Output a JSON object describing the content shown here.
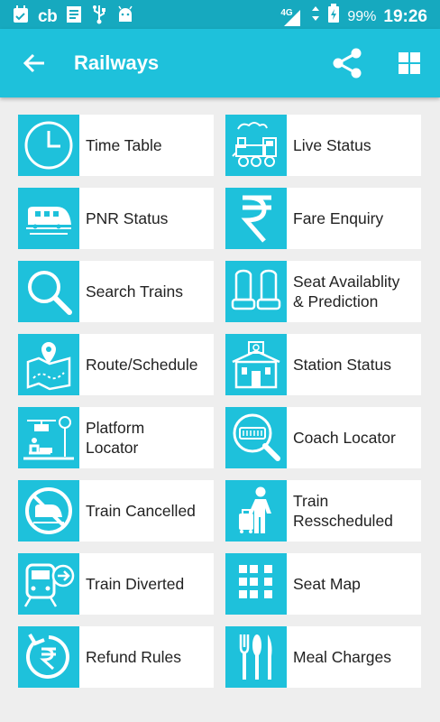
{
  "status_bar": {
    "left_icons": [
      "calendar-check-icon",
      "cb-icon",
      "document-icon",
      "usb-icon",
      "android-icon"
    ],
    "cb_text": "cb",
    "network": "4G",
    "battery": "99%",
    "time": "19:26"
  },
  "app_bar": {
    "title": "Railways",
    "back_icon": "arrow-back-icon",
    "share_icon": "share-icon",
    "grid_icon": "grid-view-icon"
  },
  "colors": {
    "status_bar": "#16a9bf",
    "app_bar": "#1ec1db",
    "icon_tile": "#1ec1db",
    "background": "#eeeeee",
    "tile": "#ffffff"
  },
  "menu": {
    "items": [
      {
        "label": "Time Table",
        "icon": "clock-icon"
      },
      {
        "label": "Live Status",
        "icon": "steam-train-icon"
      },
      {
        "label": "PNR Status",
        "icon": "bullet-train-icon"
      },
      {
        "label": "Fare Enquiry",
        "icon": "rupee-icon"
      },
      {
        "label": "Search Trains",
        "icon": "search-icon"
      },
      {
        "label": "Seat Availablity\n& Prediction",
        "icon": "seats-icon"
      },
      {
        "label": "Route/Schedule",
        "icon": "map-pin-icon"
      },
      {
        "label": "Station Status",
        "icon": "station-building-icon"
      },
      {
        "label": "Platform\nLocator",
        "icon": "platform-icon"
      },
      {
        "label": "Coach Locator",
        "icon": "coach-search-icon"
      },
      {
        "label": "Train Cancelled",
        "icon": "train-cancelled-icon"
      },
      {
        "label": "Train\nResscheduled",
        "icon": "traveler-luggage-icon"
      },
      {
        "label": "Train Diverted",
        "icon": "train-diverted-icon"
      },
      {
        "label": "Seat Map",
        "icon": "seat-map-icon"
      },
      {
        "label": "Refund Rules",
        "icon": "rupee-refund-icon"
      },
      {
        "label": "Meal Charges",
        "icon": "cutlery-icon"
      }
    ]
  }
}
